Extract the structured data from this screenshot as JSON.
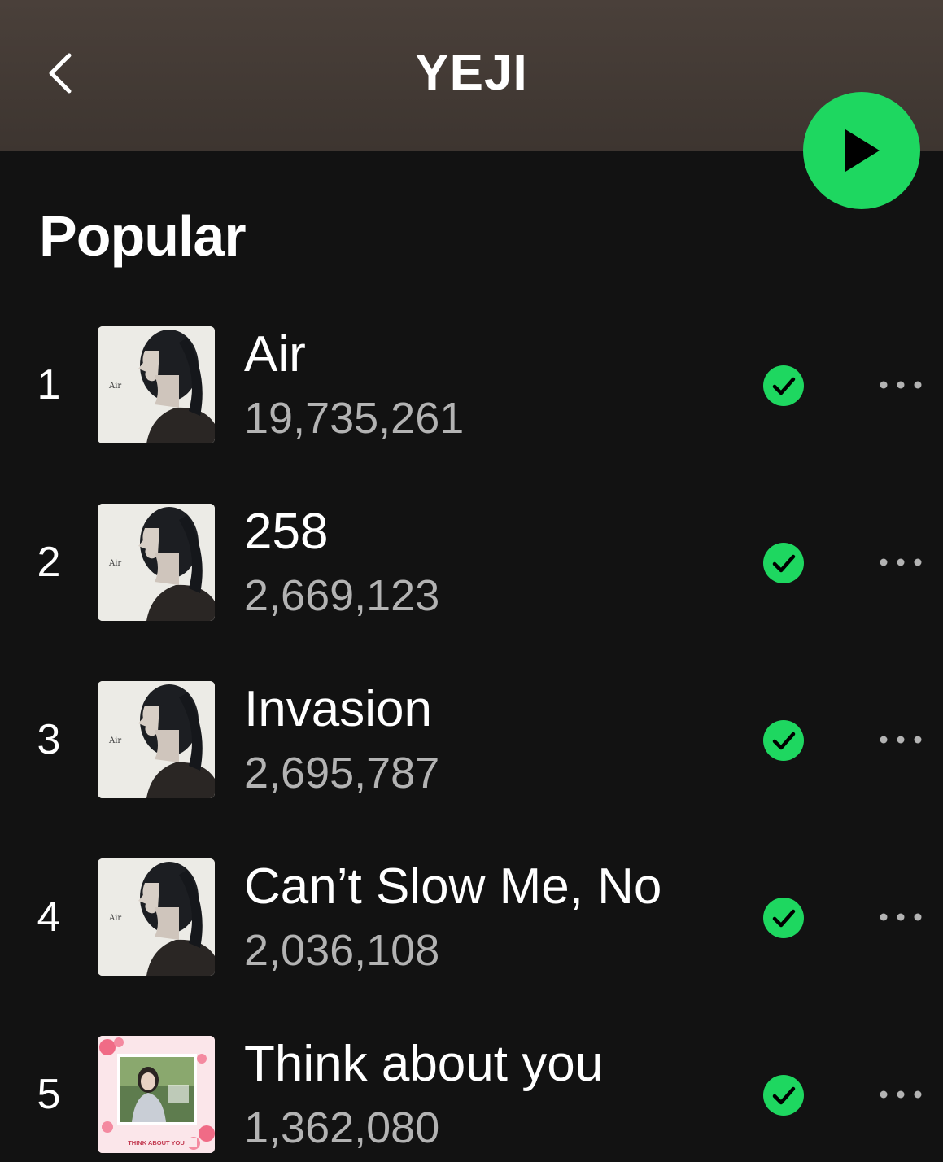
{
  "header": {
    "title": "YEJI",
    "back_icon": "chevron-left-icon",
    "play_icon": "play-icon"
  },
  "colors": {
    "accent": "#1ed760",
    "background": "#121212",
    "header_bg": "#463d37",
    "secondary_text": "#b3b3b3"
  },
  "section": {
    "title": "Popular"
  },
  "tracks": [
    {
      "rank": "1",
      "title": "Air",
      "plays": "19,735,261",
      "cover": "air-album-cover",
      "saved": true
    },
    {
      "rank": "2",
      "title": "258",
      "plays": "2,669,123",
      "cover": "air-album-cover",
      "saved": true
    },
    {
      "rank": "3",
      "title": "Invasion",
      "plays": "2,695,787",
      "cover": "air-album-cover",
      "saved": true
    },
    {
      "rank": "4",
      "title": "Can’t Slow Me, No",
      "plays": "2,036,108",
      "cover": "air-album-cover",
      "saved": true
    },
    {
      "rank": "5",
      "title": "Think about you",
      "plays": "1,362,080",
      "cover": "think-about-you-ost-cover",
      "saved": true
    }
  ]
}
